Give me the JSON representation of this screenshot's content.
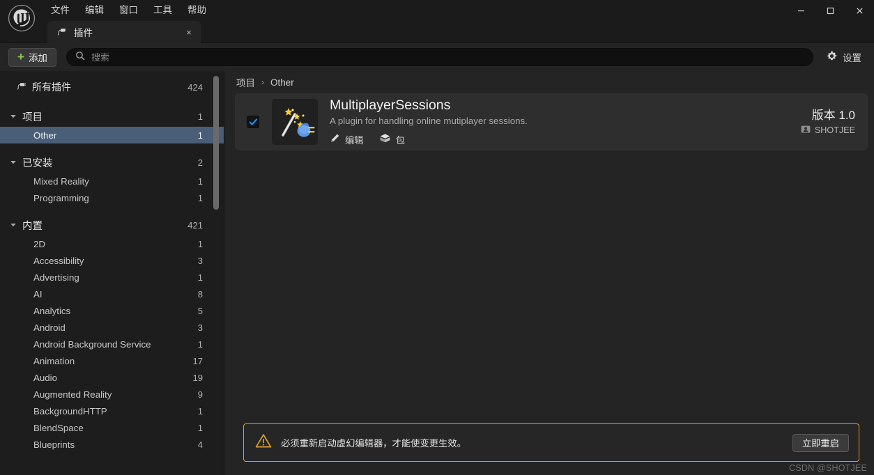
{
  "window": {
    "menus": [
      "文件",
      "编辑",
      "窗口",
      "工具",
      "帮助"
    ],
    "controls": {
      "minimize": "minimize-icon",
      "maximize": "maximize-icon",
      "close": "close-icon"
    }
  },
  "tab": {
    "label": "插件",
    "icon": "plugin-icon",
    "close": "×"
  },
  "toolbar": {
    "add_label": "添加",
    "add_plus": "+",
    "search_placeholder": "搜索",
    "search_value": "",
    "settings_label": "设置"
  },
  "sidebar": {
    "all": {
      "label": "所有插件",
      "count": "424",
      "icon": "plugin-icon"
    },
    "groups": [
      {
        "label": "项目",
        "count": "1",
        "expanded": true,
        "items": [
          {
            "label": "Other",
            "count": "1",
            "selected": true
          }
        ]
      },
      {
        "label": "已安装",
        "count": "2",
        "expanded": true,
        "items": [
          {
            "label": "Mixed Reality",
            "count": "1",
            "selected": false
          },
          {
            "label": "Programming",
            "count": "1",
            "selected": false
          }
        ]
      },
      {
        "label": "内置",
        "count": "421",
        "expanded": true,
        "items": [
          {
            "label": "2D",
            "count": "1",
            "selected": false
          },
          {
            "label": "Accessibility",
            "count": "3",
            "selected": false
          },
          {
            "label": "Advertising",
            "count": "1",
            "selected": false
          },
          {
            "label": "AI",
            "count": "8",
            "selected": false
          },
          {
            "label": "Analytics",
            "count": "5",
            "selected": false
          },
          {
            "label": "Android",
            "count": "3",
            "selected": false
          },
          {
            "label": "Android Background Service",
            "count": "1",
            "selected": false
          },
          {
            "label": "Animation",
            "count": "17",
            "selected": false
          },
          {
            "label": "Audio",
            "count": "19",
            "selected": false
          },
          {
            "label": "Augmented Reality",
            "count": "9",
            "selected": false
          },
          {
            "label": "BackgroundHTTP",
            "count": "1",
            "selected": false
          },
          {
            "label": "BlendSpace",
            "count": "1",
            "selected": false
          },
          {
            "label": "Blueprints",
            "count": "4",
            "selected": false
          }
        ]
      }
    ]
  },
  "main": {
    "breadcrumb": {
      "root": "项目",
      "separator": "›",
      "current": "Other"
    },
    "plugin": {
      "checked": true,
      "name": "MultiplayerSessions",
      "description": "A plugin for handling online mutiplayer sessions.",
      "actions": [
        {
          "label": "编辑",
          "icon": "pencil-icon"
        },
        {
          "label": "包",
          "icon": "package-icon"
        }
      ],
      "version": "版本 1.0",
      "author": "SHOTJEE",
      "author_icon": "contact-icon",
      "thumbnail_icon": "magic-wand-plug-icon"
    }
  },
  "warning": {
    "icon": "warning-triangle-icon",
    "message": "必须重新启动虚幻编辑器，才能使变更生效。",
    "button_label": "立即重启",
    "accent_color": "#e0a028"
  },
  "watermark": "CSDN @SHOTJEE",
  "colors": {
    "window_bg": "#242424",
    "titlebar_bg": "#1b1b1b",
    "sidebar_bg": "#1d1d1d",
    "selected_row": "#4a5e78",
    "card_bg": "#2e2e2e",
    "accent_green": "#8fc94e",
    "accent_blue": "#1e8fe8",
    "warning_amber": "#e0a028"
  }
}
